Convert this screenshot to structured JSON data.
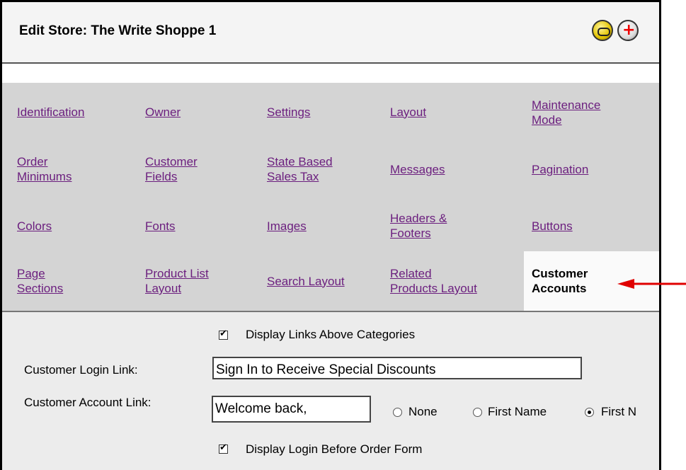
{
  "window": {
    "title": "Edit Store: The Write Shoppe 1",
    "link_icon": "link-icon",
    "help_icon": "help-icon"
  },
  "nav": {
    "row1": {
      "c1": "Identification",
      "c2": "Owner",
      "c3": "Settings",
      "c4": "Layout",
      "c5a": "Maintenance",
      "c5b": "Mode"
    },
    "row2": {
      "c1a": "Order",
      "c1b": "Minimums",
      "c2a": "Customer",
      "c2b": "Fields",
      "c3a": "State Based",
      "c3b": "Sales Tax",
      "c4": "Messages",
      "c5": "Pagination"
    },
    "row3": {
      "c1": "Colors",
      "c2": "Fonts",
      "c3": "Images",
      "c4a": "Headers &",
      "c4b": "Footers",
      "c5": "Buttons"
    },
    "row4": {
      "c1a": "Page",
      "c1b": "Sections",
      "c2a": "Product List",
      "c2b": "Layout",
      "c3": "Search Layout",
      "c4a": "Related",
      "c4b": "Products Layout",
      "c5a": "Customer",
      "c5b": "Accounts"
    },
    "link_color": "#6b1e7e"
  },
  "form": {
    "display_links_label": "Display Links Above Categories",
    "login_link_label": "Customer Login Link:",
    "login_link_value": "Sign In to Receive Special Discounts",
    "account_link_label": "Customer Account Link:",
    "account_link_value": "Welcome back,",
    "radio_none": "None",
    "radio_first_name": "First Name",
    "radio_first_n": "First N",
    "display_login_label": "Display Login Before Order Form"
  },
  "annotation": {
    "arrow_color": "#e00000"
  }
}
